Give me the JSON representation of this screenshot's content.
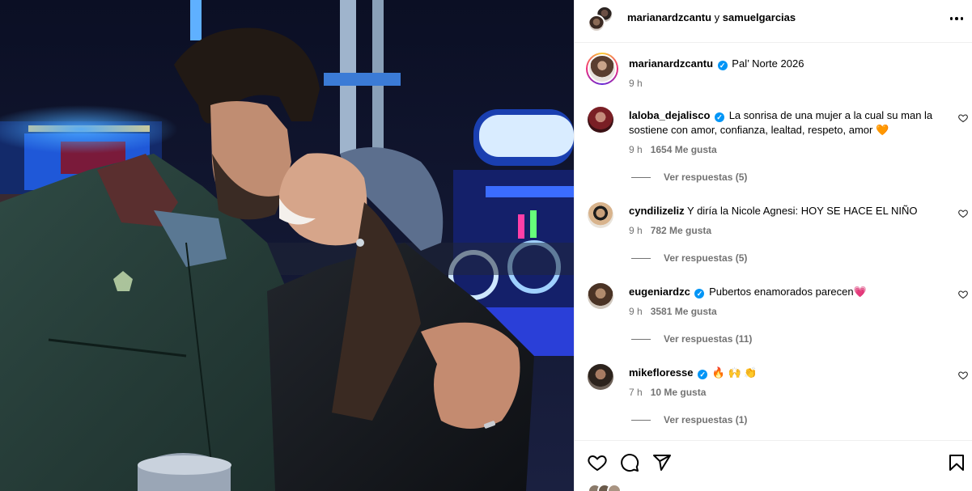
{
  "header": {
    "user1": "marianardzcantu",
    "conjunction": "y",
    "user2": "samuelgarcias"
  },
  "caption": {
    "username": "marianardzcantu",
    "text": "Pal’ Norte 2026",
    "time": "9 h"
  },
  "comments": [
    {
      "username": "laloba_dejalisco",
      "verified": true,
      "text": "La sonrisa de una mujer a la cual su man la sostiene con amor, confianza, lealtad, respeto, amor 🧡",
      "time": "9 h",
      "likes": "1654 Me gusta",
      "replies": "Ver respuestas (5)"
    },
    {
      "username": "cyndilizeliz",
      "verified": false,
      "text": "Y diría la Nicole Agnesi: HOY SE HACE EL NIÑO",
      "time": "9 h",
      "likes": "782 Me gusta",
      "replies": "Ver respuestas (5)"
    },
    {
      "username": "eugeniardzc",
      "verified": true,
      "text": "Pubertos enamorados parecen💗",
      "time": "9 h",
      "likes": "3581 Me gusta",
      "replies": "Ver respuestas (11)"
    },
    {
      "username": "mikefloresse",
      "verified": true,
      "text": "🔥 🙌 👏",
      "time": "7 h",
      "likes": "10 Me gusta",
      "replies": "Ver respuestas (1)"
    }
  ],
  "icons": {
    "like": "heart-icon",
    "comment": "comment-icon",
    "share": "share-icon",
    "save": "bookmark-icon",
    "more": "more-icon",
    "verified": "verified-badge-icon"
  },
  "colors": {
    "verified": "#0095f6",
    "muted": "#737373",
    "divider": "#efefef"
  }
}
